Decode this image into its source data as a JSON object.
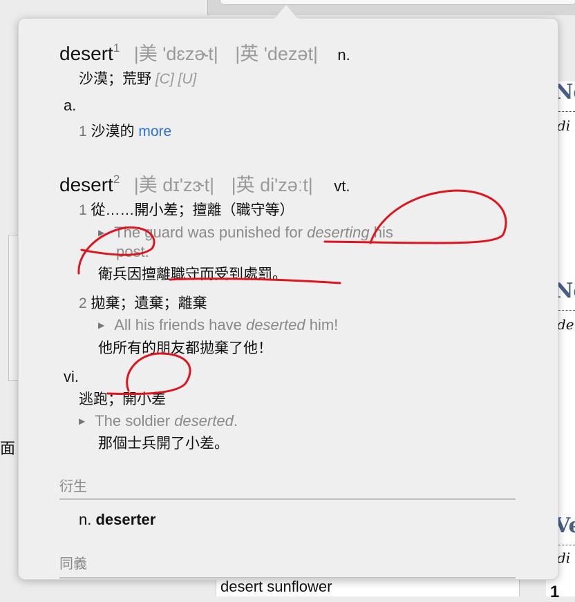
{
  "background": {
    "left_fragment": "面",
    "right_headings": [
      "No",
      "No",
      "Ve"
    ],
    "right_subs": [
      "di",
      "de",
      "di"
    ],
    "right_bottom_number": "1",
    "suggestion": "desert sunflower"
  },
  "entry1": {
    "headword": "desert",
    "sup": "1",
    "pron_us": "|美 'dɛzɚt|",
    "pron_uk": "|英 'dezət|",
    "pos": "n.",
    "def": "沙漠；荒野",
    "gram": "[C] [U]",
    "adj_pos": "a.",
    "adj_num": "1",
    "adj_def": "沙漠的",
    "more": "more"
  },
  "entry2": {
    "headword": "desert",
    "sup": "2",
    "pron_us": "|美 dɪ'zɝt|",
    "pron_uk": "|英 di'zəːt|",
    "pos": "vt.",
    "senses": [
      {
        "num": "1",
        "def": "從……開小差；擅離（職守等）",
        "ex_pre": "The guard was punished for ",
        "ex_em": "deserting",
        "ex_post": " his",
        "ex_line2": "post.",
        "trans": "衛兵因擅離職守而受到處罰。"
      },
      {
        "num": "2",
        "def": "拋棄；遺棄；離棄",
        "ex_pre": "All his friends have ",
        "ex_em": "deserted",
        "ex_post": " him!",
        "trans": "他所有的朋友都拋棄了他！"
      }
    ],
    "vi_pos": "vi.",
    "vi_def": "逃跑；開小差",
    "vi_ex_pre": "The soldier ",
    "vi_ex_em": "deserted",
    "vi_ex_post": ".",
    "vi_trans": "那個士兵開了小差。"
  },
  "derivatives": {
    "title": "衍生",
    "pos": "n.",
    "word": "deserter"
  },
  "synonyms": {
    "title": "同義"
  },
  "colors": {
    "annotation": "#e0141e",
    "link": "#2a6fd6"
  }
}
